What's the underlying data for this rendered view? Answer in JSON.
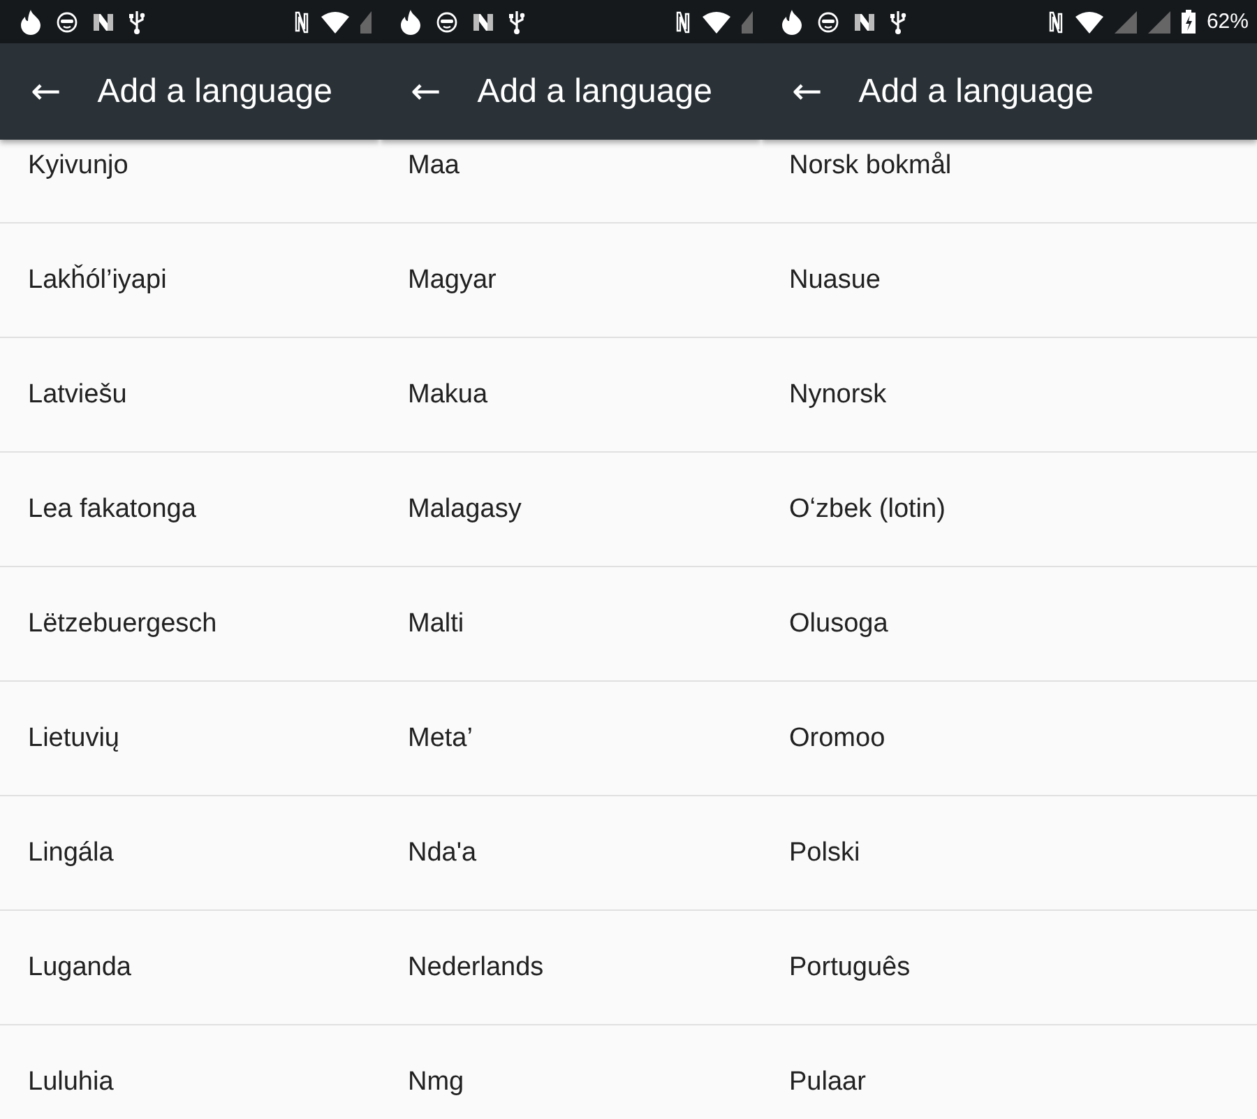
{
  "screens": [
    {
      "toolbar": {
        "back": "←",
        "title": "Add a language"
      },
      "languages": [
        "Kyivunjo",
        "Lakȟól’iyapi",
        "Latviešu",
        "Lea fakatonga",
        "Lëtzebuergesch",
        "Lietuvių",
        "Lingála",
        "Luganda",
        "Luluhia"
      ]
    },
    {
      "toolbar": {
        "back": "←",
        "title": "Add a language"
      },
      "languages": [
        "Maa",
        "Magyar",
        "Makua",
        "Malagasy",
        "Malti",
        "Meta’",
        "Nda'a",
        "Nederlands",
        "Nmg"
      ]
    },
    {
      "status_bar": {
        "battery": "62%"
      },
      "toolbar": {
        "back": "←",
        "title": "Add a language"
      },
      "languages": [
        "Norsk bokmål",
        "Nuasue",
        "Nynorsk",
        "Oʻzbek (lotin)",
        "Olusoga",
        "Oromoo",
        "Polski",
        "Português",
        "Pulaar"
      ]
    }
  ]
}
